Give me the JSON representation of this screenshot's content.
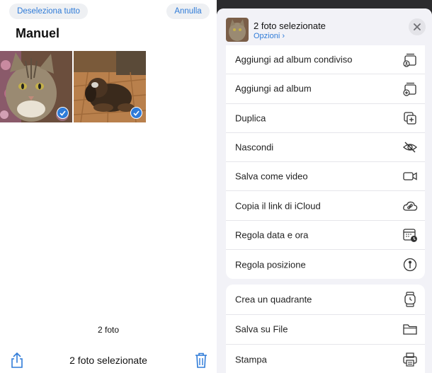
{
  "left": {
    "deselect_label": "Deseleziona tutto",
    "cancel_label": "Annulla",
    "album_title": "Manuel",
    "photo_count": "2 foto",
    "selection_label": "2 foto selezionate",
    "photos": [
      {
        "subject": "cat",
        "selected": true
      },
      {
        "subject": "dog",
        "selected": true
      }
    ]
  },
  "sheet": {
    "title": "2 foto selezionate",
    "options_label": "Opzioni ›",
    "actions_group1": [
      {
        "label": "Aggiungi ad album condiviso",
        "icon": "shared-album-icon"
      },
      {
        "label": "Aggiungi ad album",
        "icon": "add-album-icon"
      },
      {
        "label": "Duplica",
        "icon": "duplicate-icon"
      },
      {
        "label": "Nascondi",
        "icon": "hide-eye-icon"
      },
      {
        "label": "Salva come video",
        "icon": "video-camera-icon"
      },
      {
        "label": "Copia il link di iCloud",
        "icon": "icloud-link-icon"
      },
      {
        "label": "Regola data e ora",
        "icon": "calendar-clock-icon"
      },
      {
        "label": "Regola posizione",
        "icon": "location-pin-icon"
      }
    ],
    "actions_group2": [
      {
        "label": "Crea un quadrante",
        "icon": "watch-face-icon"
      },
      {
        "label": "Salva su File",
        "icon": "folder-icon"
      },
      {
        "label": "Stampa",
        "icon": "printer-icon"
      }
    ]
  },
  "colors": {
    "accent": "#2f7bd8",
    "sheet_bg": "#f2f2f7",
    "backdrop": "#2c2c2e"
  }
}
